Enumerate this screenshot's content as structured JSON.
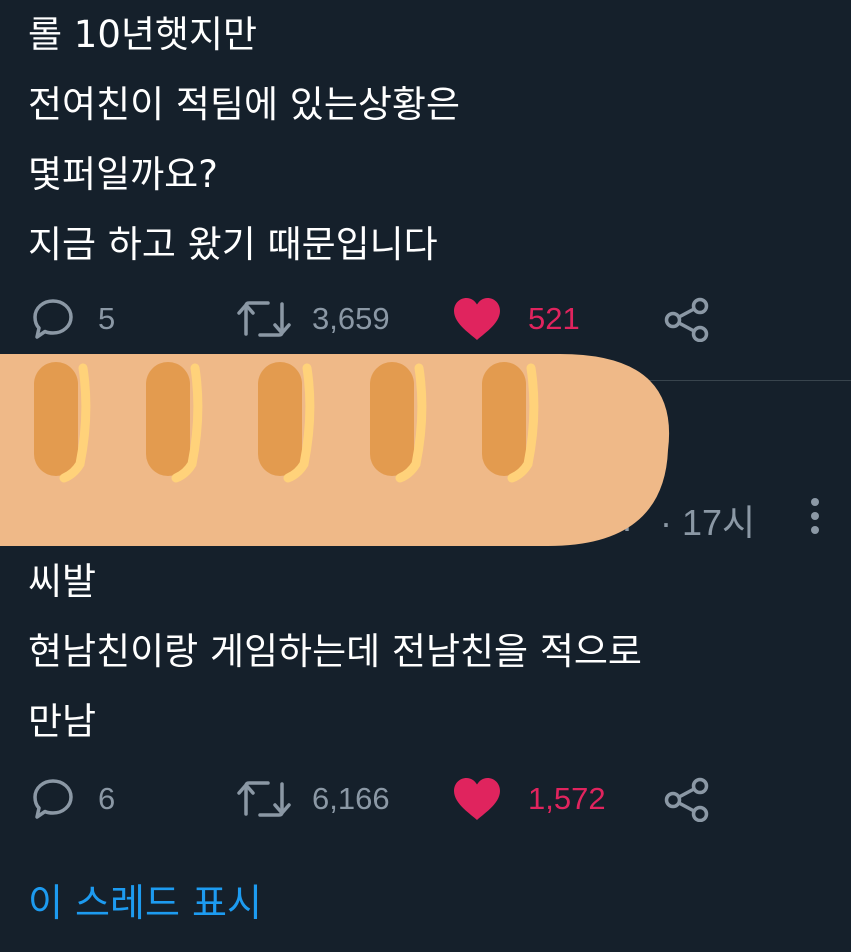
{
  "tweet1": {
    "lines": [
      "롤 10년햇지만",
      "전여친이 적팀에 있는상황은",
      "몇퍼일까요?",
      "지금 하고 왔기 때문입니다"
    ],
    "replies": "5",
    "retweets": "3,659",
    "likes": "521"
  },
  "tweet2": {
    "ellipsis": "...",
    "time": "· 17시",
    "lines": [
      "씨발",
      "현남친이랑 게임하는데 전남친을 적으로",
      "만남"
    ],
    "replies": "6",
    "retweets": "6,166",
    "likes": "1,572"
  },
  "show_thread": "이 스레드 표시",
  "colors": {
    "background": "#15202b",
    "muted": "#8b98a5",
    "like": "#e0245e",
    "link": "#1d9bf0",
    "divider": "#38444d"
  },
  "icons": [
    "reply-icon",
    "retweet-icon",
    "heart-icon",
    "share-icon",
    "more-options-icon",
    "baguette-sticker"
  ]
}
